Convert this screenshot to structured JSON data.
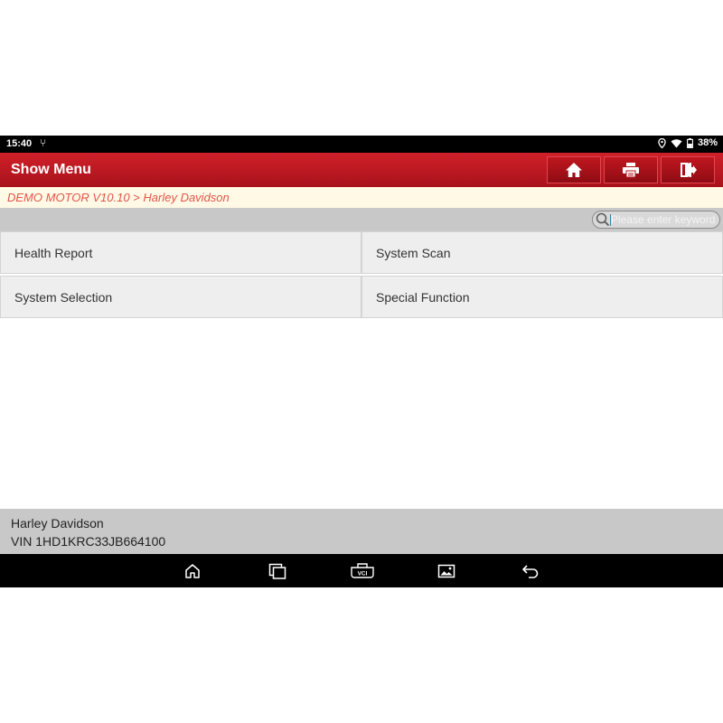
{
  "status_bar": {
    "time": "15:40",
    "battery": "38%"
  },
  "header": {
    "title": "Show Menu"
  },
  "breadcrumb": {
    "text": "DEMO MOTOR V10.10 > Harley Davidson"
  },
  "search": {
    "placeholder": "Please enter keyword"
  },
  "menu": {
    "items": [
      {
        "label": "Health Report"
      },
      {
        "label": "System Scan"
      },
      {
        "label": "System Selection"
      },
      {
        "label": "Special Function"
      }
    ]
  },
  "vehicle": {
    "model": "Harley Davidson",
    "vin": "VIN 1HD1KRC33JB664100"
  },
  "nav": {
    "vci_label": "VCI"
  },
  "colors": {
    "header_red": "#c0161f",
    "breadcrumb_text": "#e2554a"
  }
}
